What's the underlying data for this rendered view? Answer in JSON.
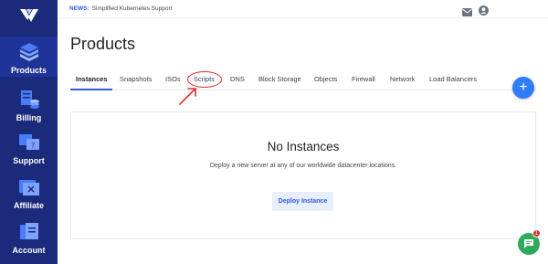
{
  "news": {
    "label": "NEWS:",
    "text": "Simplified Kubernetes Support"
  },
  "sidebar": {
    "items": [
      {
        "label": "Products",
        "icon": "products-icon"
      },
      {
        "label": "Billing",
        "icon": "billing-icon"
      },
      {
        "label": "Support",
        "icon": "support-icon"
      },
      {
        "label": "Affiliate",
        "icon": "affiliate-icon"
      },
      {
        "label": "Account",
        "icon": "account-icon"
      }
    ]
  },
  "page": {
    "title": "Products"
  },
  "tabs": [
    {
      "label": "Instances",
      "active": true
    },
    {
      "label": "Snapshots"
    },
    {
      "label": "ISOs"
    },
    {
      "label": "Scripts"
    },
    {
      "label": "DNS"
    },
    {
      "label": "Block Storage"
    },
    {
      "label": "Objects"
    },
    {
      "label": "Firewall"
    },
    {
      "label": "Network"
    },
    {
      "label": "Load Balancers"
    }
  ],
  "empty_state": {
    "title": "No Instances",
    "subtitle": "Deploy a new server at any of our worldwide datacenter locations.",
    "button": "Deploy Instance"
  },
  "fab": {
    "symbol": "+"
  },
  "chat": {
    "badge": "1"
  },
  "colors": {
    "sidebar": "#1b2a7a",
    "accent": "#2d5be3",
    "annotation": "#e0302b",
    "chat": "#2eaa5c"
  }
}
